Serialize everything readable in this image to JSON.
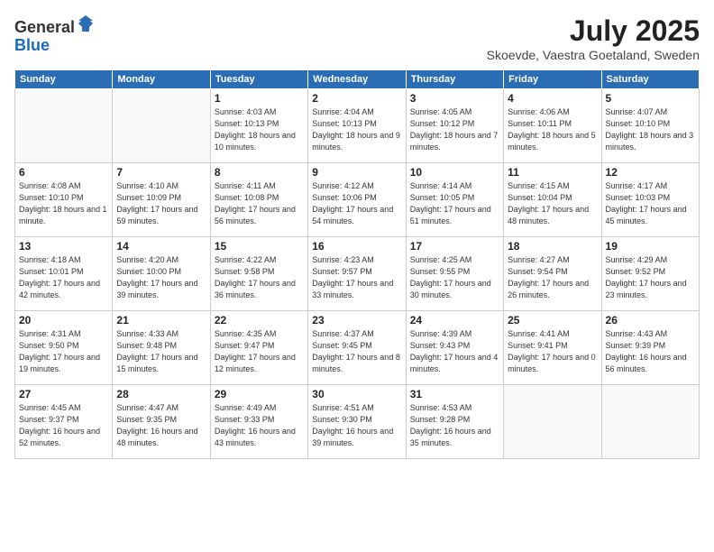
{
  "logo": {
    "general": "General",
    "blue": "Blue"
  },
  "header": {
    "month": "July 2025",
    "location": "Skoevde, Vaestra Goetaland, Sweden"
  },
  "weekdays": [
    "Sunday",
    "Monday",
    "Tuesday",
    "Wednesday",
    "Thursday",
    "Friday",
    "Saturday"
  ],
  "weeks": [
    [
      {
        "day": "",
        "info": ""
      },
      {
        "day": "",
        "info": ""
      },
      {
        "day": "1",
        "info": "Sunrise: 4:03 AM\nSunset: 10:13 PM\nDaylight: 18 hours\nand 10 minutes."
      },
      {
        "day": "2",
        "info": "Sunrise: 4:04 AM\nSunset: 10:13 PM\nDaylight: 18 hours\nand 9 minutes."
      },
      {
        "day": "3",
        "info": "Sunrise: 4:05 AM\nSunset: 10:12 PM\nDaylight: 18 hours\nand 7 minutes."
      },
      {
        "day": "4",
        "info": "Sunrise: 4:06 AM\nSunset: 10:11 PM\nDaylight: 18 hours\nand 5 minutes."
      },
      {
        "day": "5",
        "info": "Sunrise: 4:07 AM\nSunset: 10:10 PM\nDaylight: 18 hours\nand 3 minutes."
      }
    ],
    [
      {
        "day": "6",
        "info": "Sunrise: 4:08 AM\nSunset: 10:10 PM\nDaylight: 18 hours\nand 1 minute."
      },
      {
        "day": "7",
        "info": "Sunrise: 4:10 AM\nSunset: 10:09 PM\nDaylight: 17 hours\nand 59 minutes."
      },
      {
        "day": "8",
        "info": "Sunrise: 4:11 AM\nSunset: 10:08 PM\nDaylight: 17 hours\nand 56 minutes."
      },
      {
        "day": "9",
        "info": "Sunrise: 4:12 AM\nSunset: 10:06 PM\nDaylight: 17 hours\nand 54 minutes."
      },
      {
        "day": "10",
        "info": "Sunrise: 4:14 AM\nSunset: 10:05 PM\nDaylight: 17 hours\nand 51 minutes."
      },
      {
        "day": "11",
        "info": "Sunrise: 4:15 AM\nSunset: 10:04 PM\nDaylight: 17 hours\nand 48 minutes."
      },
      {
        "day": "12",
        "info": "Sunrise: 4:17 AM\nSunset: 10:03 PM\nDaylight: 17 hours\nand 45 minutes."
      }
    ],
    [
      {
        "day": "13",
        "info": "Sunrise: 4:18 AM\nSunset: 10:01 PM\nDaylight: 17 hours\nand 42 minutes."
      },
      {
        "day": "14",
        "info": "Sunrise: 4:20 AM\nSunset: 10:00 PM\nDaylight: 17 hours\nand 39 minutes."
      },
      {
        "day": "15",
        "info": "Sunrise: 4:22 AM\nSunset: 9:58 PM\nDaylight: 17 hours\nand 36 minutes."
      },
      {
        "day": "16",
        "info": "Sunrise: 4:23 AM\nSunset: 9:57 PM\nDaylight: 17 hours\nand 33 minutes."
      },
      {
        "day": "17",
        "info": "Sunrise: 4:25 AM\nSunset: 9:55 PM\nDaylight: 17 hours\nand 30 minutes."
      },
      {
        "day": "18",
        "info": "Sunrise: 4:27 AM\nSunset: 9:54 PM\nDaylight: 17 hours\nand 26 minutes."
      },
      {
        "day": "19",
        "info": "Sunrise: 4:29 AM\nSunset: 9:52 PM\nDaylight: 17 hours\nand 23 minutes."
      }
    ],
    [
      {
        "day": "20",
        "info": "Sunrise: 4:31 AM\nSunset: 9:50 PM\nDaylight: 17 hours\nand 19 minutes."
      },
      {
        "day": "21",
        "info": "Sunrise: 4:33 AM\nSunset: 9:48 PM\nDaylight: 17 hours\nand 15 minutes."
      },
      {
        "day": "22",
        "info": "Sunrise: 4:35 AM\nSunset: 9:47 PM\nDaylight: 17 hours\nand 12 minutes."
      },
      {
        "day": "23",
        "info": "Sunrise: 4:37 AM\nSunset: 9:45 PM\nDaylight: 17 hours\nand 8 minutes."
      },
      {
        "day": "24",
        "info": "Sunrise: 4:39 AM\nSunset: 9:43 PM\nDaylight: 17 hours\nand 4 minutes."
      },
      {
        "day": "25",
        "info": "Sunrise: 4:41 AM\nSunset: 9:41 PM\nDaylight: 17 hours\nand 0 minutes."
      },
      {
        "day": "26",
        "info": "Sunrise: 4:43 AM\nSunset: 9:39 PM\nDaylight: 16 hours\nand 56 minutes."
      }
    ],
    [
      {
        "day": "27",
        "info": "Sunrise: 4:45 AM\nSunset: 9:37 PM\nDaylight: 16 hours\nand 52 minutes."
      },
      {
        "day": "28",
        "info": "Sunrise: 4:47 AM\nSunset: 9:35 PM\nDaylight: 16 hours\nand 48 minutes."
      },
      {
        "day": "29",
        "info": "Sunrise: 4:49 AM\nSunset: 9:33 PM\nDaylight: 16 hours\nand 43 minutes."
      },
      {
        "day": "30",
        "info": "Sunrise: 4:51 AM\nSunset: 9:30 PM\nDaylight: 16 hours\nand 39 minutes."
      },
      {
        "day": "31",
        "info": "Sunrise: 4:53 AM\nSunset: 9:28 PM\nDaylight: 16 hours\nand 35 minutes."
      },
      {
        "day": "",
        "info": ""
      },
      {
        "day": "",
        "info": ""
      }
    ]
  ]
}
